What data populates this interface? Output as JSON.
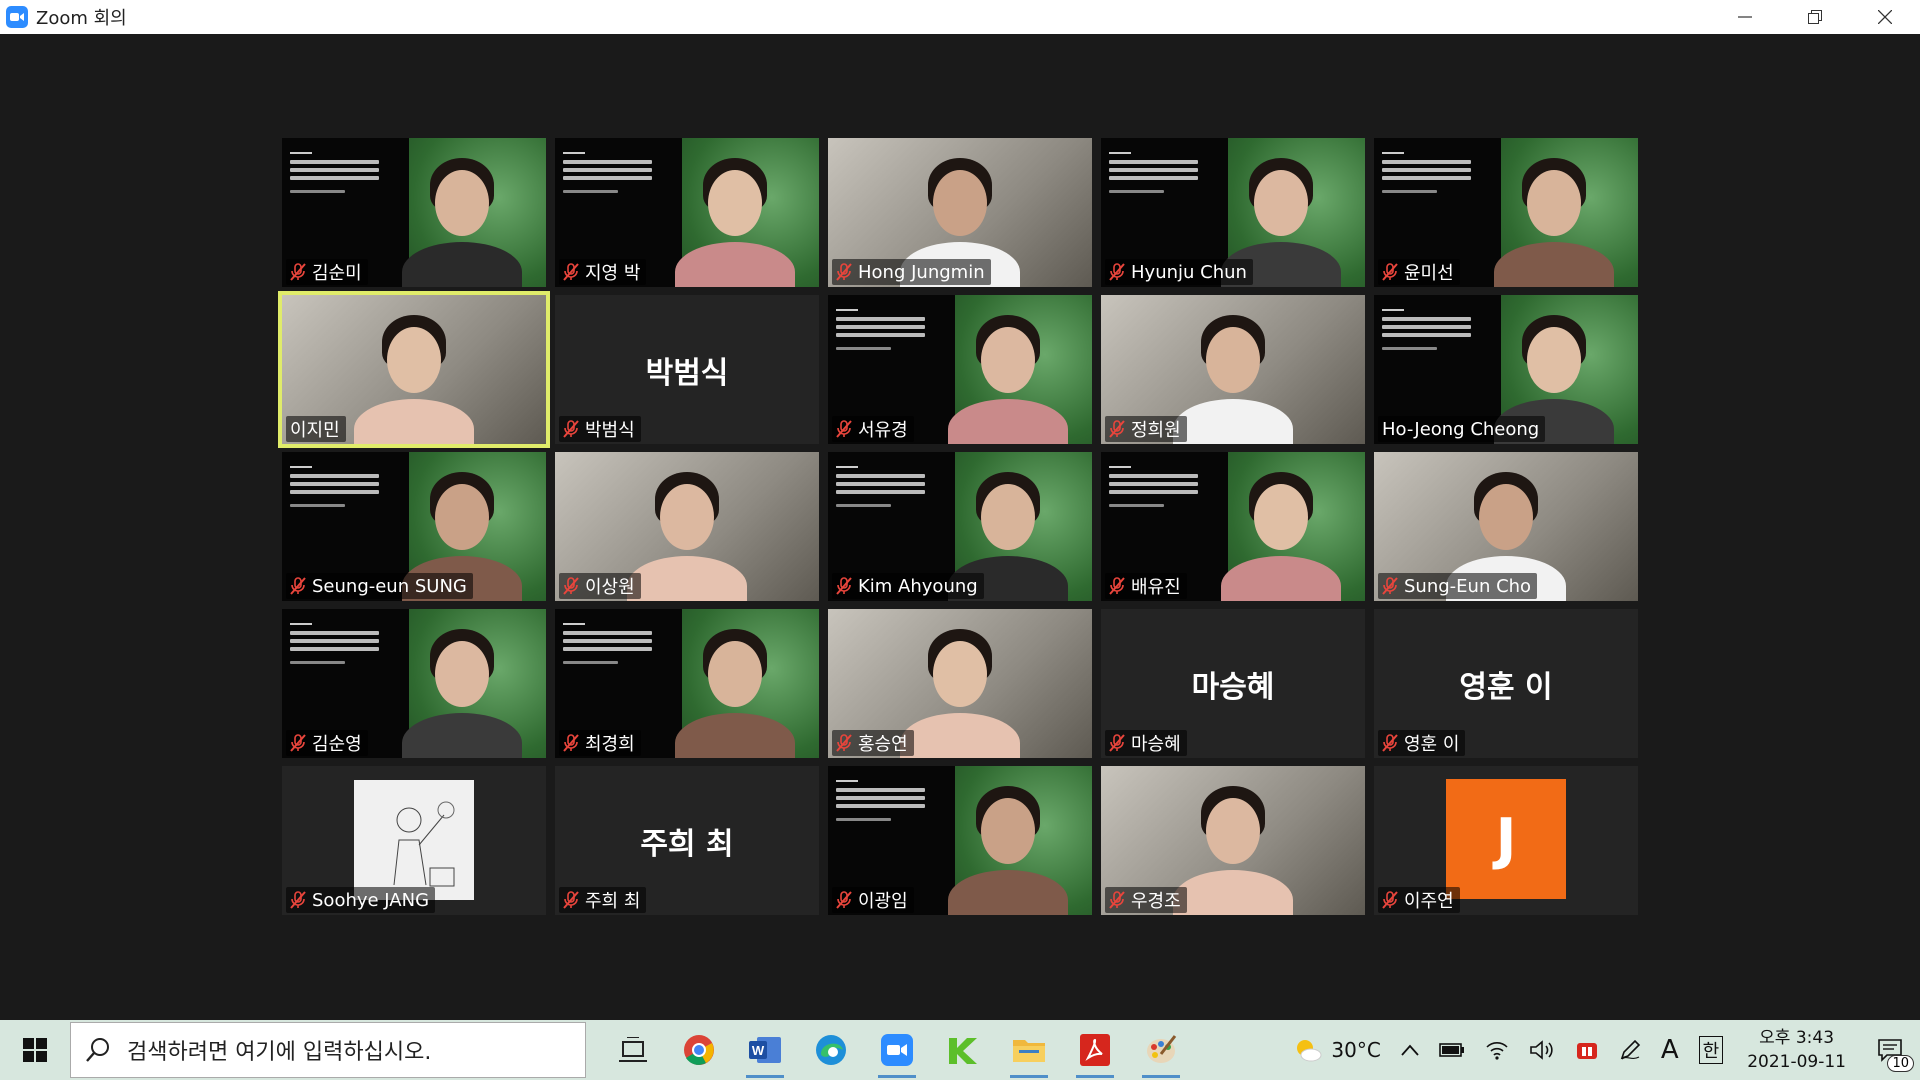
{
  "window": {
    "title": "Zoom 회의"
  },
  "tiles": [
    {
      "name": "김순미",
      "muted": true,
      "video": true
    },
    {
      "name": "지영 박",
      "muted": true,
      "video": true
    },
    {
      "name": "Hong Jungmin",
      "muted": true,
      "video": true
    },
    {
      "name": "Hyunju Chun",
      "muted": true,
      "video": true
    },
    {
      "name": "윤미선",
      "muted": true,
      "video": true
    },
    {
      "name": "이지민",
      "muted": false,
      "video": true,
      "active": true
    },
    {
      "name": "박범식",
      "muted": true,
      "video": false
    },
    {
      "name": "서유경",
      "muted": true,
      "video": true
    },
    {
      "name": "정희원",
      "muted": true,
      "video": true
    },
    {
      "name": "Ho-Jeong Cheong",
      "muted": false,
      "video": true
    },
    {
      "name": "Seung-eun SUNG",
      "muted": true,
      "video": true
    },
    {
      "name": "이상원",
      "muted": true,
      "video": true
    },
    {
      "name": "Kim Ahyoung",
      "muted": true,
      "video": true
    },
    {
      "name": "배유진",
      "muted": true,
      "video": true
    },
    {
      "name": "Sung-Eun Cho",
      "muted": true,
      "video": true
    },
    {
      "name": "김순영",
      "muted": true,
      "video": true
    },
    {
      "name": "최경희",
      "muted": true,
      "video": true
    },
    {
      "name": "홍승연",
      "muted": true,
      "video": true
    },
    {
      "name": "마승혜",
      "muted": true,
      "video": false
    },
    {
      "name": "영훈 이",
      "muted": true,
      "video": false
    },
    {
      "name": "Soohye JANG",
      "muted": true,
      "video": false,
      "avatar": "sketch"
    },
    {
      "name": "주희 최",
      "muted": true,
      "video": false
    },
    {
      "name": "이광임",
      "muted": true,
      "video": true
    },
    {
      "name": "우경조",
      "muted": true,
      "video": true
    },
    {
      "name": "이주연",
      "muted": true,
      "video": false,
      "avatar": "J"
    }
  ],
  "slide_text": {
    "line1": "2021 한국통역번역학회 ·",
    "line2": "동국대 번역학연구소",
    "line3": "가을 공동 학술대회"
  },
  "taskbar": {
    "search_placeholder": "검색하려면 여기에 입력하십시오.",
    "weather": "30°C",
    "ime_mode": "A",
    "ime_lang": "한",
    "time": "오후 3:43",
    "date": "2021-09-11",
    "notification_count": "10"
  },
  "colors": {
    "active_speaker": "#e0ec6a",
    "mute_icon": "#e8453c",
    "avatar_j": "#f26b16",
    "taskbar": "#d7e7de"
  }
}
